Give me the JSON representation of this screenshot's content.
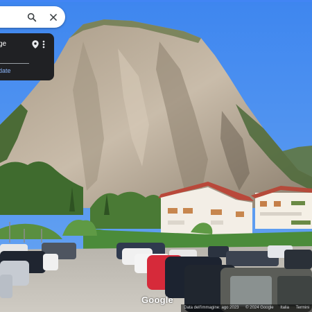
{
  "search_bar": {
    "search_icon": "search-icon",
    "close_icon": "close-icon"
  },
  "info_card": {
    "title": "ge",
    "link_text": "date",
    "pin_icon": "place-pin-icon",
    "more_icon": "more-vert-icon"
  },
  "brand": {
    "logo_text": "Google"
  },
  "footer": {
    "image_date": "Data dell'immagine: ago 2023",
    "copyright": "© 2024 Google",
    "terms": "Italia",
    "terms2": "Termini"
  },
  "colors": {
    "sky": "#4a8ff0",
    "card_bg": "#202124",
    "link": "#8ab4f8"
  }
}
